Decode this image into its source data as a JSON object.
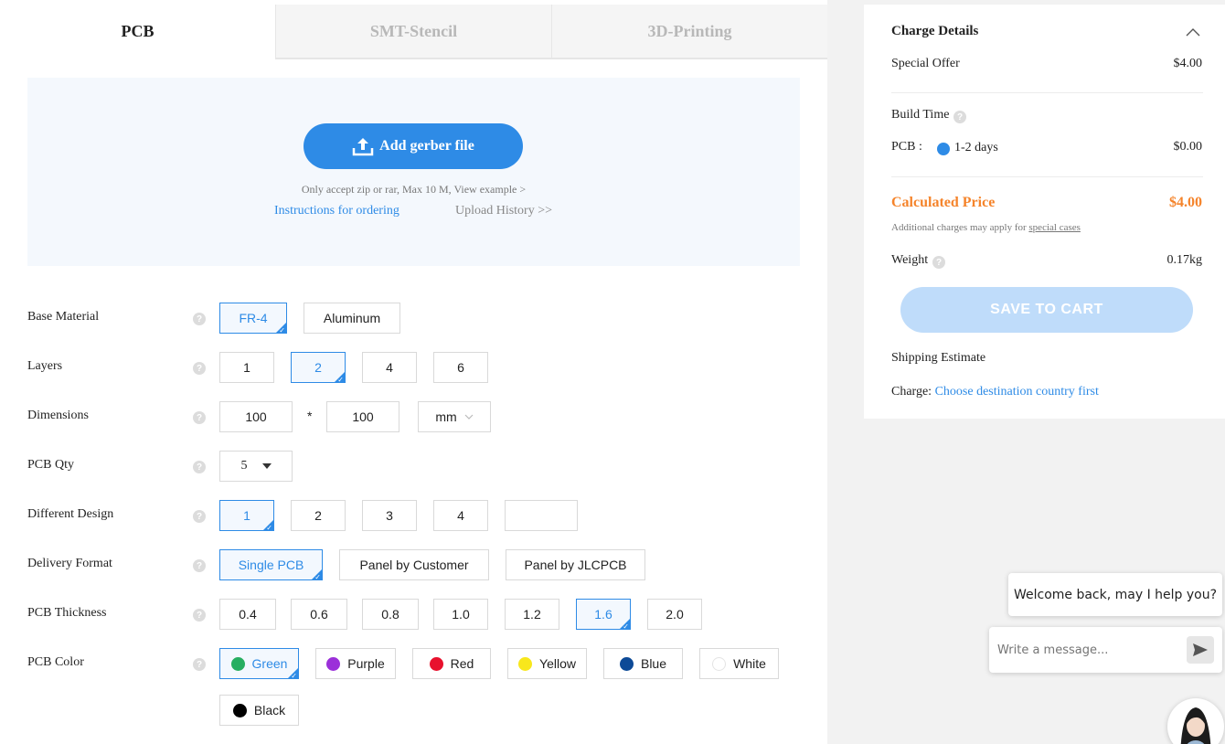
{
  "tabs": [
    {
      "label": "PCB",
      "active": true
    },
    {
      "label": "SMT-Stencil",
      "active": false
    },
    {
      "label": "3D-Printing",
      "active": false
    }
  ],
  "upload": {
    "button_label": "Add gerber file",
    "note": "Only accept zip or rar, Max 10 M, View example >",
    "instructions_link": "Instructions for ordering",
    "history_link": "Upload History >>"
  },
  "form": {
    "help_glyph": "?",
    "base_material": {
      "label": "Base Material",
      "options": [
        "FR-4",
        "Aluminum"
      ],
      "selected": "FR-4"
    },
    "layers": {
      "label": "Layers",
      "options": [
        "1",
        "2",
        "4",
        "6"
      ],
      "selected": "2"
    },
    "dimensions": {
      "label": "Dimensions",
      "width": "100",
      "separator": "*",
      "height": "100",
      "unit": "mm"
    },
    "pcb_qty": {
      "label": "PCB Qty",
      "value": "5"
    },
    "different_design": {
      "label": "Different Design",
      "options": [
        "1",
        "2",
        "3",
        "4"
      ],
      "custom_value": "",
      "selected": "1"
    },
    "delivery_format": {
      "label": "Delivery Format",
      "options": [
        "Single PCB",
        "Panel by Customer",
        "Panel by JLCPCB"
      ],
      "selected": "Single PCB"
    },
    "pcb_thickness": {
      "label": "PCB Thickness",
      "options": [
        "0.4",
        "0.6",
        "0.8",
        "1.0",
        "1.2",
        "1.6",
        "2.0"
      ],
      "selected": "1.6"
    },
    "pcb_color": {
      "label": "PCB Color",
      "selected": "Green",
      "options": [
        {
          "name": "Green",
          "color": "#27ae60"
        },
        {
          "name": "Purple",
          "color": "#9b30d9"
        },
        {
          "name": "Red",
          "color": "#e8112d"
        },
        {
          "name": "Yellow",
          "color": "#f8e71c"
        },
        {
          "name": "Blue",
          "color": "#0d4a97"
        },
        {
          "name": "White",
          "color": "#ffffff"
        },
        {
          "name": "Black",
          "color": "#000000"
        }
      ]
    }
  },
  "charge": {
    "title": "Charge Details",
    "special_offer_label": "Special Offer",
    "special_offer_value": "$4.00",
    "build_time_label": "Build Time",
    "pcb_label": "PCB :",
    "build_option": "1-2 days",
    "build_price": "$0.00",
    "calculated_label": "Calculated Price",
    "calculated_value": "$4.00",
    "additional_note": "Additional charges may apply for",
    "special_cases": "special cases",
    "weight_label": "Weight",
    "weight_value": "0.17kg",
    "save_label": "SAVE TO CART",
    "shipping_label": "Shipping Estimate",
    "charge_label": "Charge:",
    "charge_link": "Choose destination country first"
  },
  "chat": {
    "welcome": "Welcome back, may I help you?",
    "placeholder": "Write a message..."
  },
  "colors": {
    "accent": "#2e8be6",
    "price_orange": "#f5842b",
    "save_disabled": "#bfdcfa"
  }
}
